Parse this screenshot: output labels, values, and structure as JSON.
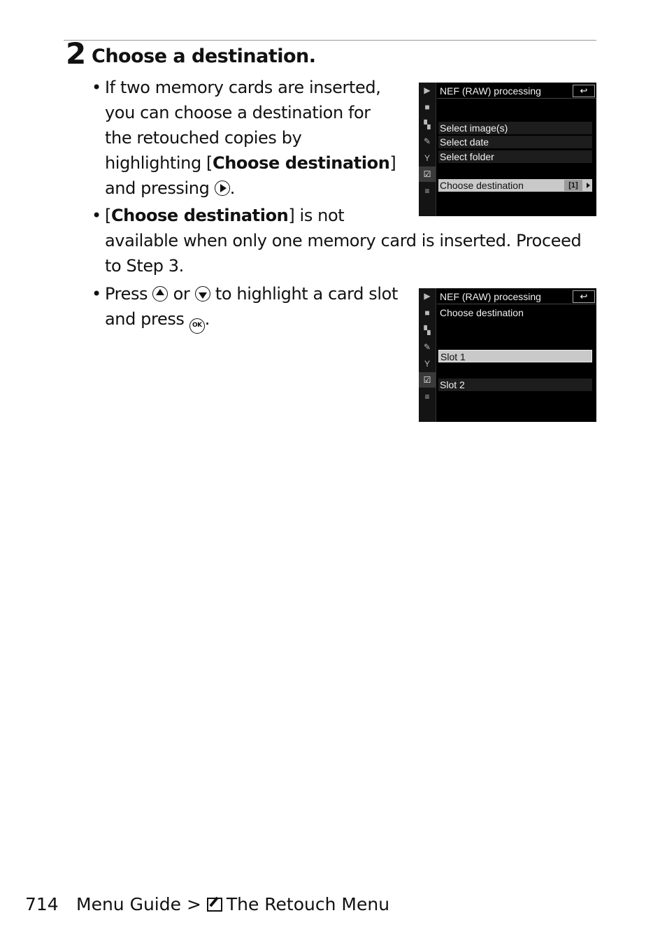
{
  "step": {
    "number": "2",
    "title": "Choose a destination."
  },
  "bullets": [
    {
      "lines": [
        "If two memory cards are inserted,",
        "you can choose a destination for",
        "the retouched copies by"
      ],
      "line4_pre": "highlighting [",
      "line4_bold": "Choose destination",
      "line4_post": "]",
      "line5_pre": "and pressing",
      "line5_icon": "multi-selector-right-icon",
      "line5_post": "."
    },
    {
      "pre": "[",
      "bold": "Choose destination",
      "post": "] is not",
      "line2": "available when only one memory card is inserted. Proceed",
      "line3": "to Step 3."
    },
    {
      "pre": "Press",
      "icon1": "multi-selector-up-icon",
      "mid": "or",
      "icon2": "multi-selector-down-icon",
      "post": "to highlight a card slot",
      "line2_pre": "and press",
      "line2_icon": "ok-button-icon",
      "line2_post": "."
    }
  ],
  "screens": [
    {
      "title": "NEF (RAW) processing",
      "back_label": "↩",
      "items": [
        "Select image(s)",
        "Select date",
        "Select folder"
      ],
      "highlighted_item": "Choose destination",
      "highlighted_value": "[1]"
    },
    {
      "title": "NEF (RAW) processing",
      "back_label": "↩",
      "subtitle": "Choose destination",
      "items": [
        "Slot 1",
        "Slot 2"
      ],
      "selected": "Slot 1"
    }
  ],
  "side_icons": [
    "playback-icon",
    "photo-shooting-icon",
    "movie-shooting-icon",
    "custom-settings-icon",
    "setup-icon",
    "retouch-icon",
    "my-menu-icon"
  ],
  "footer": {
    "page_number": "714",
    "breadcrumb_section": "Menu Guide",
    "separator": ">",
    "breadcrumb_page": "The Retouch Menu"
  }
}
